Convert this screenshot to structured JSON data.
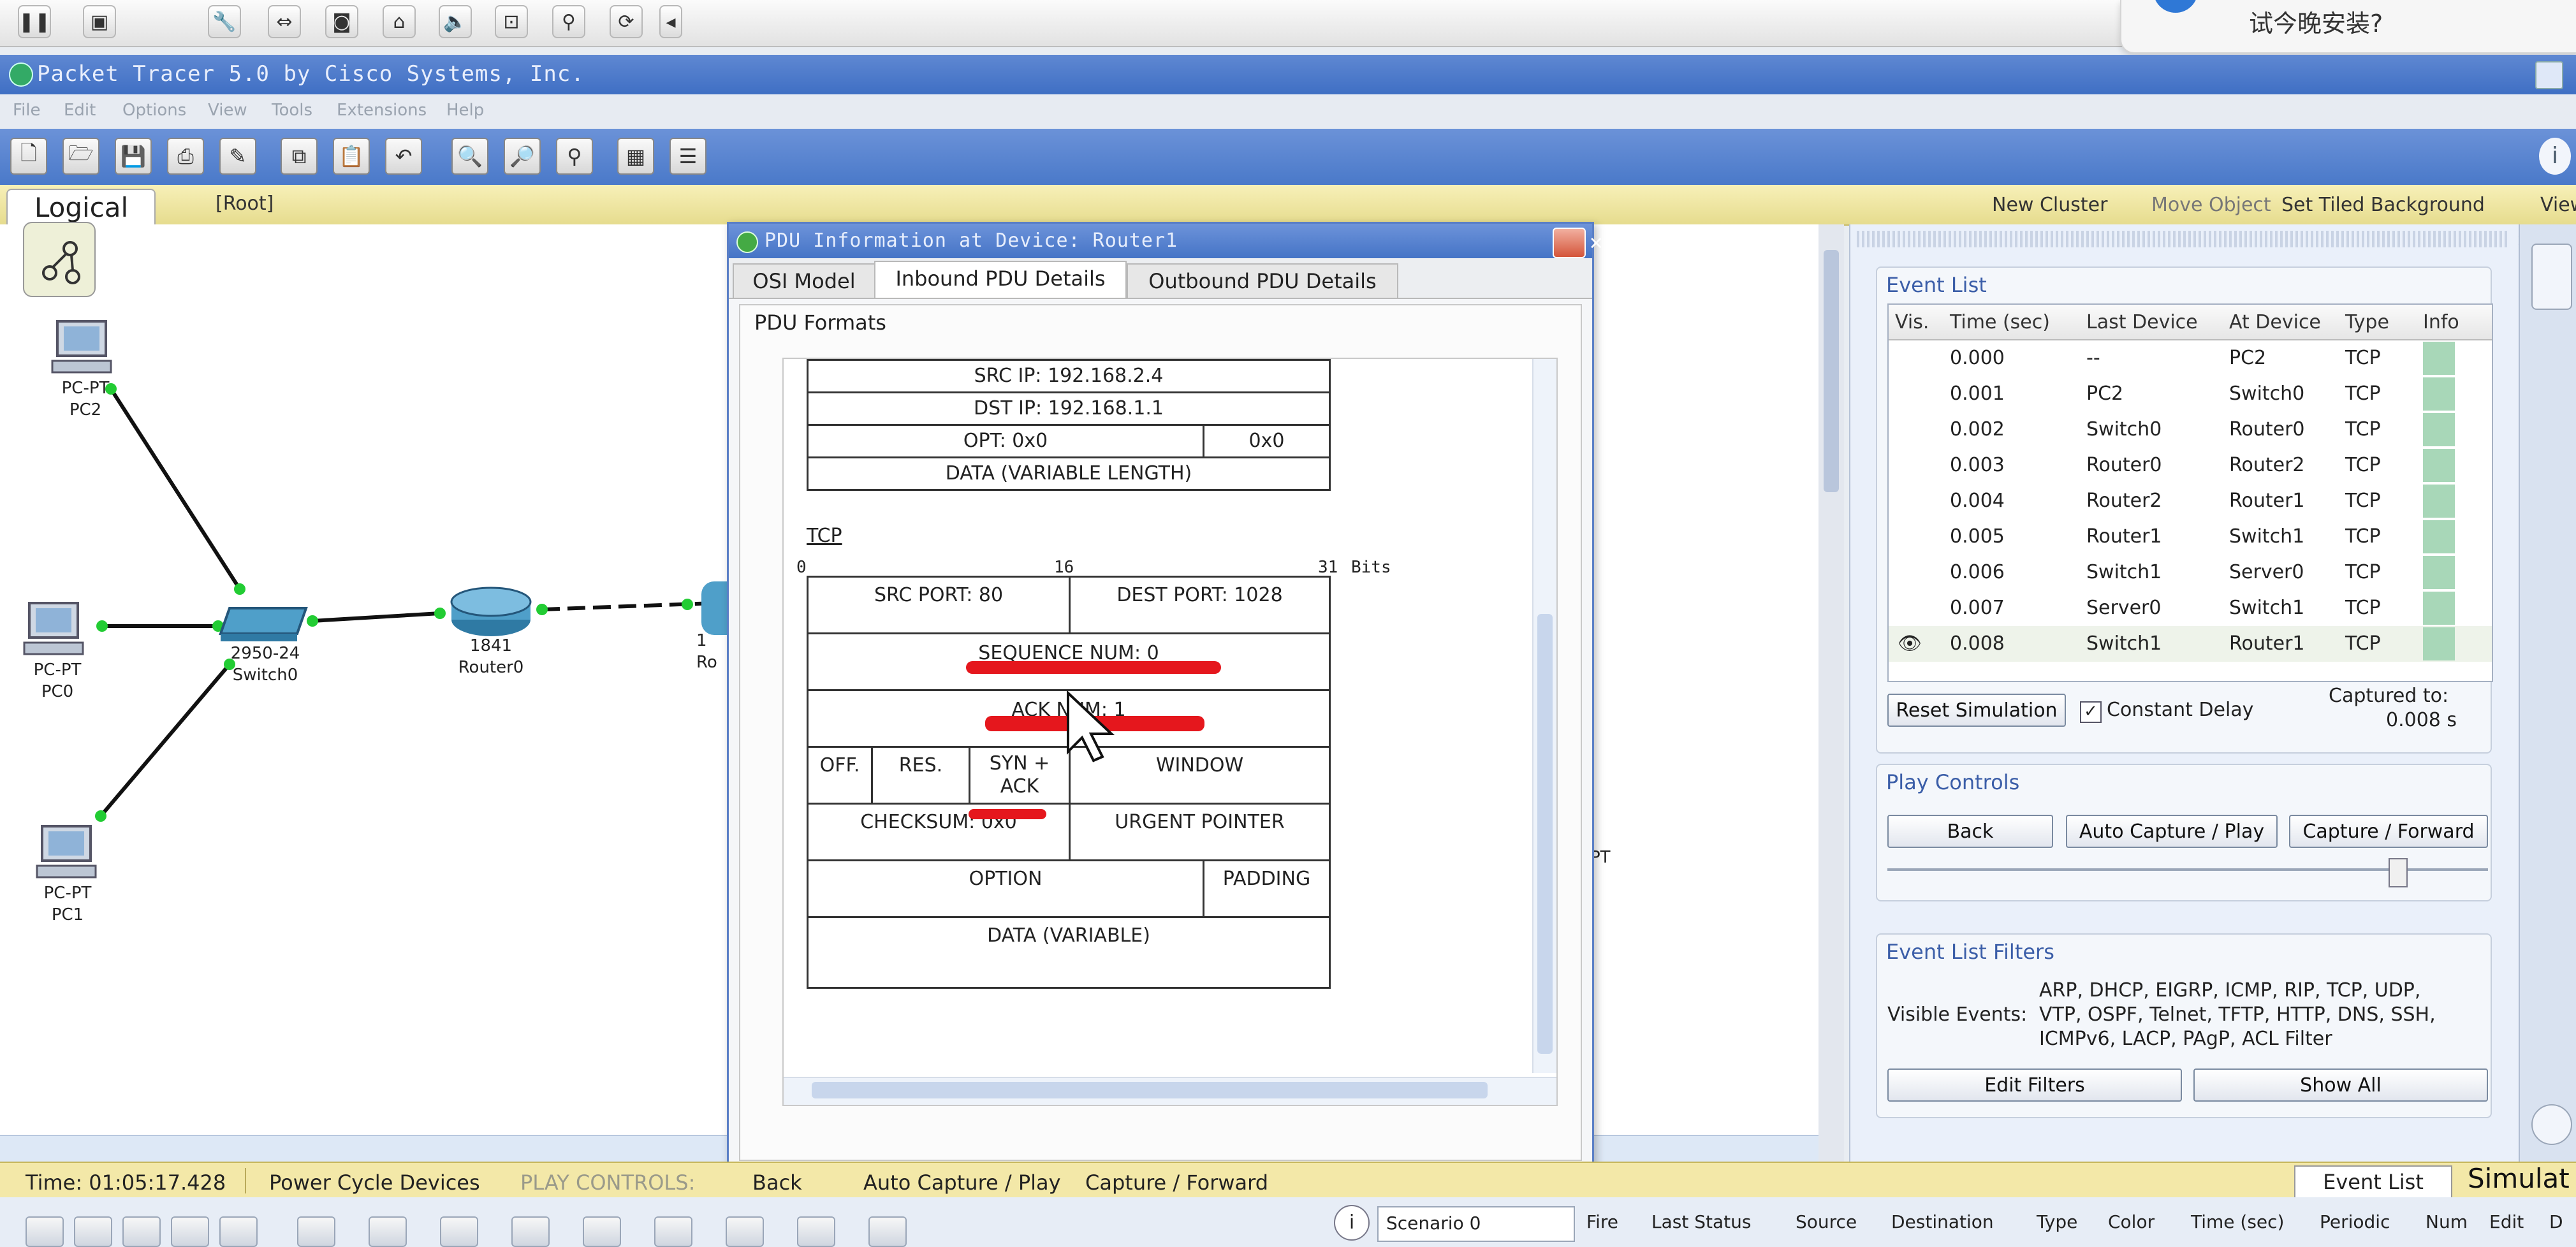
{
  "notification": {
    "text": "试今晚安装?"
  },
  "window": {
    "title": "Packet Tracer 5.0 by Cisco Systems, Inc."
  },
  "menu": [
    "File",
    "Edit",
    "Options",
    "View",
    "Tools",
    "Extensions",
    "Help"
  ],
  "workspace": {
    "logical_label": "Logical",
    "root_label": "[Root]",
    "actions": [
      "New Cluster",
      "Move Object",
      "Set Tiled Background",
      "View"
    ]
  },
  "topology": {
    "devices": [
      {
        "type": "PC-PT",
        "name": "PC2"
      },
      {
        "type": "PC-PT",
        "name": "PC0"
      },
      {
        "type": "PC-PT",
        "name": "PC1"
      },
      {
        "type": "2950-24",
        "name": "Switch0"
      },
      {
        "type": "1841",
        "name": "Router0"
      },
      {
        "type": "1",
        "name": "Ro"
      }
    ],
    "partial_label": "PT"
  },
  "pdu_dialog": {
    "title": "PDU Information at Device: Router1",
    "tabs": [
      "OSI Model",
      "Inbound PDU Details",
      "Outbound PDU Details"
    ],
    "active_tab": "Inbound PDU Details",
    "formats_label": "PDU Formats",
    "ip_rows": {
      "src_ip": "SRC IP: 192.168.2.4",
      "dst_ip": "DST IP: 192.168.1.1",
      "opt": "OPT: 0x0",
      "opt_pad": "0x0",
      "data": "DATA (VARIABLE LENGTH)"
    },
    "tcp": {
      "title": "TCP",
      "scale": {
        "start": "0",
        "mid": "16",
        "end": "31",
        "unit": "Bits"
      },
      "src_port": "SRC PORT: 80",
      "dest_port": "DEST PORT: 1028",
      "seq": "SEQUENCE NUM: 0",
      "ack": "ACK NUM: 1",
      "off": "OFF.",
      "res": "RES.",
      "flags": "SYN + ACK",
      "window": "WINDOW",
      "checksum": "CHECKSUM: 0x0",
      "urgent": "URGENT POINTER",
      "option": "OPTION",
      "padding": "PADDING",
      "data": "DATA (VARIABLE)"
    }
  },
  "event_list": {
    "title": "Event List",
    "columns": [
      "Vis.",
      "Time (sec)",
      "Last Device",
      "At Device",
      "Type",
      "Info"
    ],
    "rows": [
      {
        "time": "0.000",
        "last": "--",
        "at": "PC2",
        "type": "TCP"
      },
      {
        "time": "0.001",
        "last": "PC2",
        "at": "Switch0",
        "type": "TCP"
      },
      {
        "time": "0.002",
        "last": "Switch0",
        "at": "Router0",
        "type": "TCP"
      },
      {
        "time": "0.003",
        "last": "Router0",
        "at": "Router2",
        "type": "TCP"
      },
      {
        "time": "0.004",
        "last": "Router2",
        "at": "Router1",
        "type": "TCP"
      },
      {
        "time": "0.005",
        "last": "Router1",
        "at": "Switch1",
        "type": "TCP"
      },
      {
        "time": "0.006",
        "last": "Switch1",
        "at": "Server0",
        "type": "TCP"
      },
      {
        "time": "0.007",
        "last": "Server0",
        "at": "Switch1",
        "type": "TCP"
      },
      {
        "time": "0.008",
        "last": "Switch1",
        "at": "Router1",
        "type": "TCP"
      }
    ],
    "reset_label": "Reset Simulation",
    "constant_delay_label": "Constant Delay",
    "constant_delay_checked": true,
    "captured_label": "Captured to:",
    "captured_value": "0.008 s"
  },
  "play_controls": {
    "title": "Play Controls",
    "back": "Back",
    "auto": "Auto Capture / Play",
    "capture": "Capture / Forward"
  },
  "filters": {
    "title": "Event List Filters",
    "visible_label": "Visible Events:",
    "visible_line1": "ARP, DHCP, EIGRP, ICMP, RIP, TCP, UDP,",
    "visible_line2": "VTP, OSPF, Telnet, TFTP, HTTP, DNS, SSH,",
    "visible_line3": "ICMPv6, LACP, PAgP, ACL Filter",
    "edit": "Edit Filters",
    "show_all": "Show All"
  },
  "status": {
    "time": "Time: 01:05:17.428",
    "power": "Power Cycle Devices",
    "play_controls": "PLAY CONTROLS:",
    "back": "Back",
    "auto": "Auto Capture / Play",
    "capture": "Capture / Forward",
    "event_list_btn": "Event List",
    "simulation": "Simulat"
  },
  "bottom": {
    "scenario": "Scenario 0",
    "columns": [
      "Fire",
      "Last Status",
      "Source",
      "Destination",
      "Type",
      "Color",
      "Time (sec)",
      "Periodic",
      "Num",
      "Edit",
      "D"
    ]
  },
  "colors": {
    "accent": "#4a79c9",
    "highlight_red": "#e5171d",
    "info_green": "#a8d7b8",
    "link_green": "#22cc33"
  }
}
